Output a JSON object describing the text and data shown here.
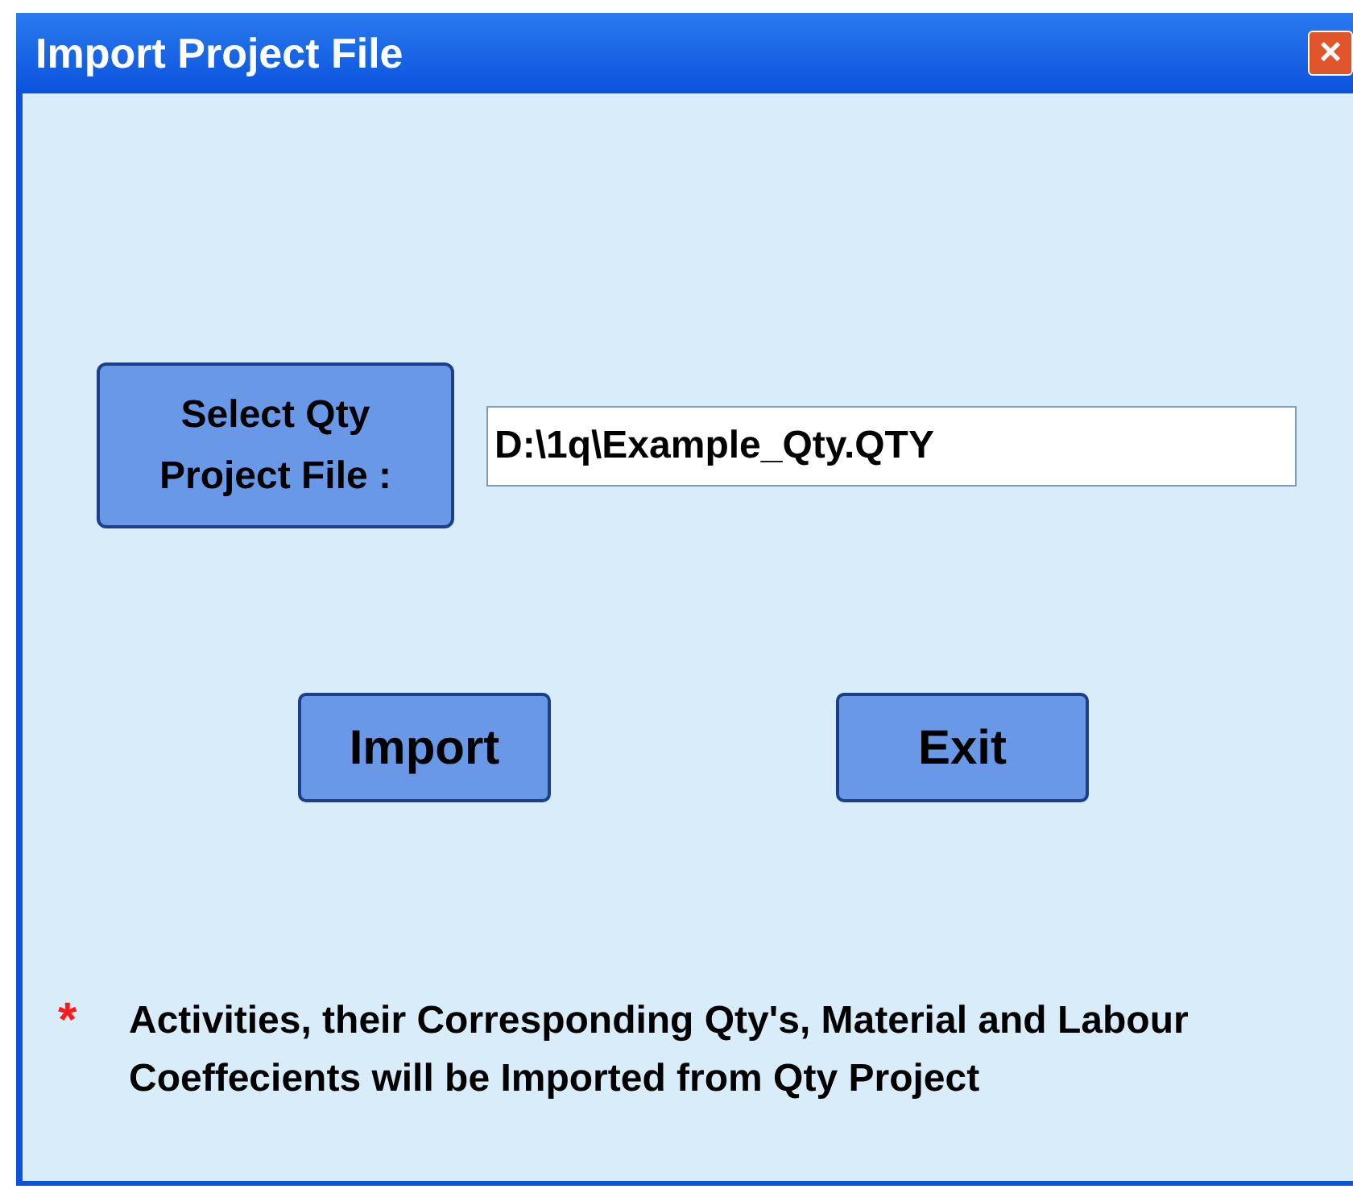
{
  "window": {
    "title": "Import Project File",
    "close": "×"
  },
  "file_button": {
    "label_lines": [
      "Select Qty",
      "Project File :"
    ]
  },
  "file_field": {
    "value": "D:\\1q\\Example_Qty.QTY"
  },
  "buttons": [
    "Import",
    "Exit"
  ],
  "note": {
    "mark": "*",
    "text": "Activities, their Corresponding Qty's, Material and Labour Coeffecients will be Imported from Qty Project"
  }
}
